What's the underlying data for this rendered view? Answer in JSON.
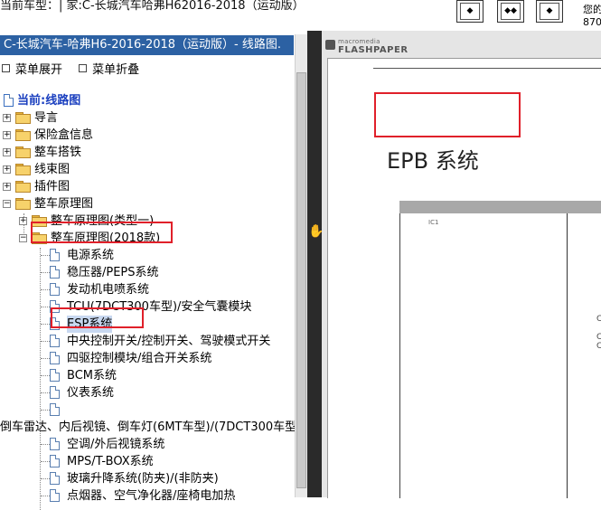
{
  "top": {
    "current_vehicle": "当前车型：|  家:C-长城汽车哈弗H62016-2018（运动版）",
    "right_text_1": "您的",
    "right_text_2": "870",
    "nav_buttons": [
      {
        "name": "nav-button-first",
        "glyph": "◆"
      },
      {
        "name": "nav-button-split",
        "glyph": "◆◆"
      },
      {
        "name": "nav-button-last",
        "glyph": "◆"
      }
    ]
  },
  "left": {
    "title": "C-长城汽车-哈弗H6-2016-2018（运动版）- 线路图.",
    "menu": {
      "expand": "菜单展开",
      "collapse": "菜单折叠"
    },
    "root_label": "当前:线路图",
    "top_folders": [
      "导言",
      "保险盒信息",
      "整车搭铁",
      "线束图",
      "插件图",
      "整车原理图"
    ],
    "sub_folders": [
      "整车原理图(类型一)",
      "整车原理图(2018款)"
    ],
    "docs": [
      "电源系统",
      "稳压器/PEPS系统",
      "发动机电喷系统",
      "TCU(7DCT300车型)/安全气囊模块",
      "ESP系统",
      "中央控制开关/控制开关、驾驶模式开关",
      "四驱控制模块/组合开关系统",
      "BCM系统",
      "仪表系统",
      ""
    ],
    "wrapped_line": "倒车雷达、内后视镜、倒车灯(6MT车型)/(7DCT300车型",
    "docs_after": [
      "空调/外后视镜系统",
      "MPS/T-BOX系统",
      "玻璃升降系统(防夹)/(非防夹)",
      "点烟器、空气净化器/座椅电加热"
    ]
  },
  "viewer": {
    "brand_small": "macromedia",
    "brand_big": "FLASHPAPER",
    "page_title": "EPB 系统",
    "ic_label": "IC1"
  },
  "colors": {
    "title_bar": "#2c61a3",
    "highlight_box": "#e0202a",
    "splitter": "#2a2a2a"
  }
}
